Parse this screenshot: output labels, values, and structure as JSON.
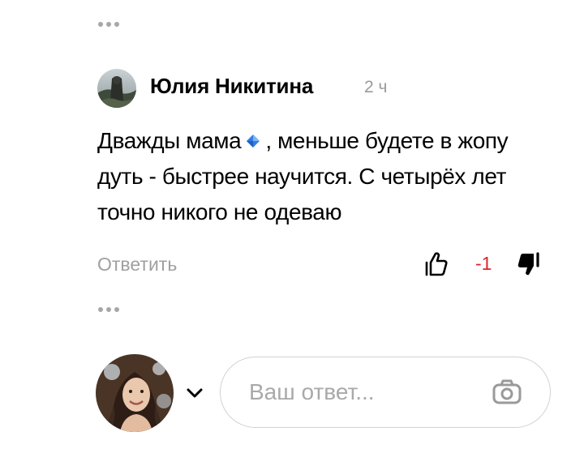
{
  "comment": {
    "author_name": "Юлия Никитина",
    "time": "2 ч",
    "text_before_emoji": "Дважды мама",
    "emoji_icon": "blue-diamond-icon",
    "text_after_emoji": ", меньше будете в жопу дуть - быстрее научится. С четырёх лет точно никого не одеваю",
    "reply_label": "Ответить",
    "rating": "-1",
    "like_icon": "thumbs-up-outline-icon",
    "dislike_icon": "thumbs-down-filled-icon"
  },
  "reply_form": {
    "placeholder": "Ваш ответ...",
    "value": "",
    "camera_icon": "camera-icon",
    "account_switch_icon": "chevron-down-icon"
  },
  "colors": {
    "text": "#000000",
    "muted": "#a0a0a0",
    "rating_negative": "#d9282f",
    "border": "#d2d2d2",
    "dots": "#a7a7a7",
    "diamond": "#2f7de8"
  }
}
